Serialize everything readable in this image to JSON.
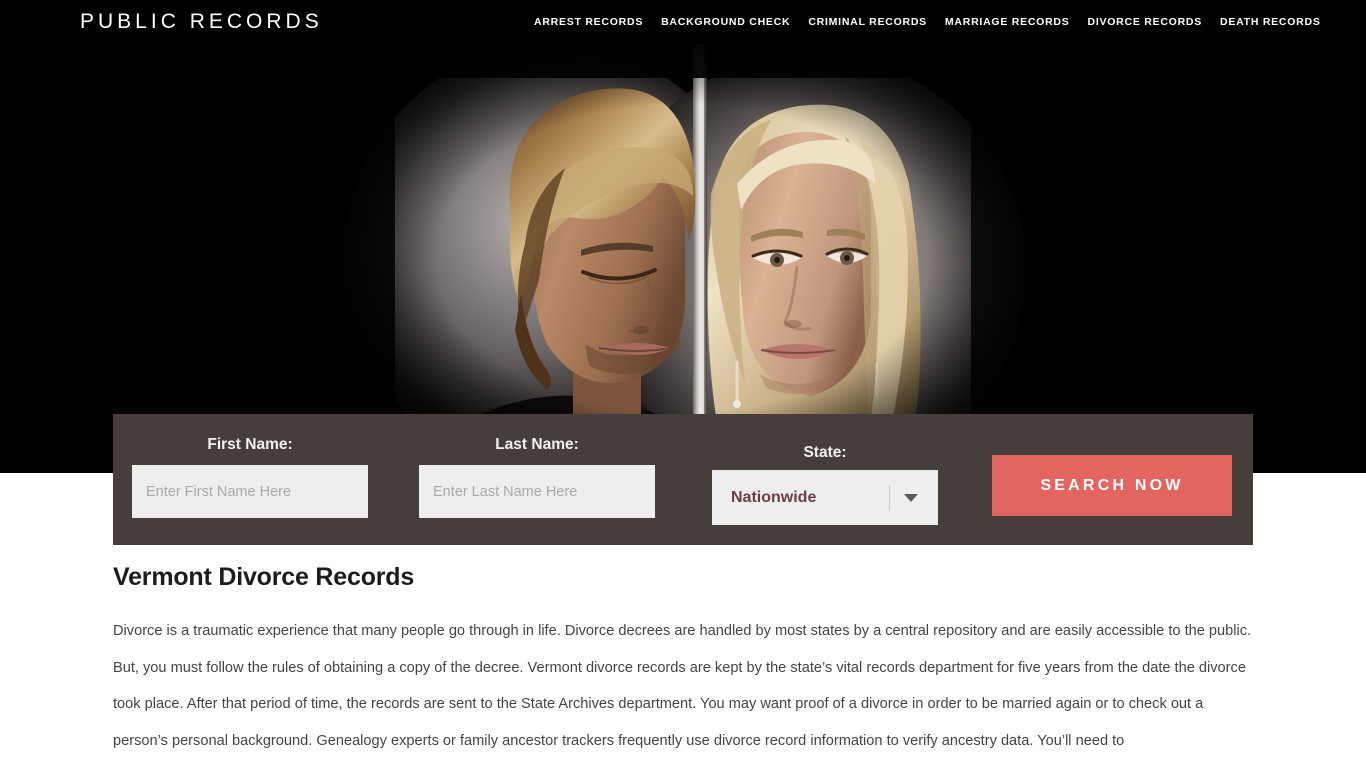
{
  "header": {
    "logo": "PUBLIC RECORDS",
    "nav": [
      {
        "label": "ARREST RECORDS"
      },
      {
        "label": "BACKGROUND CHECK"
      },
      {
        "label": "CRIMINAL RECORDS"
      },
      {
        "label": "MARRIAGE RECORDS"
      },
      {
        "label": "DIVORCE RECORDS"
      },
      {
        "label": "DEATH RECORDS"
      }
    ]
  },
  "hero": {
    "image_alt": "Couple separated by a wall - man on left with eyes closed, woman on right looking down"
  },
  "search": {
    "first_name": {
      "label": "First Name:",
      "placeholder": "Enter First Name Here",
      "value": ""
    },
    "last_name": {
      "label": "Last Name:",
      "placeholder": "Enter Last Name Here",
      "value": ""
    },
    "state": {
      "label": "State:",
      "selected": "Nationwide"
    },
    "submit_label": "Search Now"
  },
  "article": {
    "title": "Vermont Divorce Records",
    "body": "Divorce is a traumatic experience that many people go through in life. Divorce decrees are handled by most states by a central repository and are easily accessible to the public. But, you must follow the rules of obtaining a copy of the decree. Vermont divorce records are kept by the state’s vital records department for five years from the date the divorce took place. After that period of time, the records are sent to the State Archives department. You may want proof of a divorce in order to be married again or to check out a person’s personal background. Genealogy experts or family ancestor trackers frequently use divorce record information to verify ancestry data. You’ll need to"
  },
  "colors": {
    "panel": "#463e3a",
    "accent_button": "#e2655f",
    "select_text": "#6e3c45",
    "hero_background": "#000000",
    "input_background": "#eeeeee"
  }
}
